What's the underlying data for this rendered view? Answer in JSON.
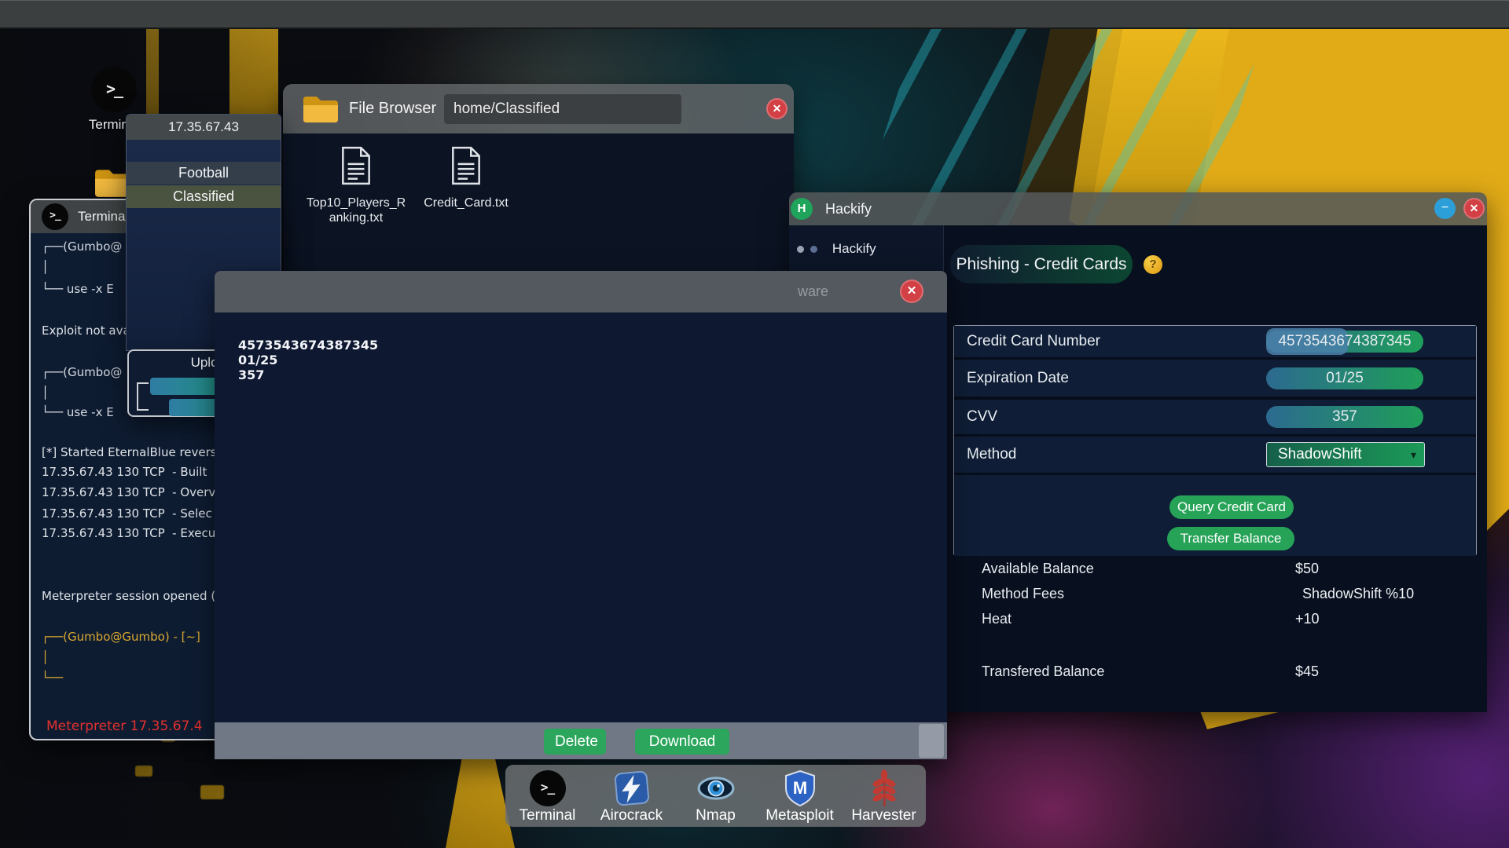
{
  "desktop": {
    "terminal_icon_label": "Terminal",
    "dock": [
      {
        "label": "Terminal"
      },
      {
        "label": "Airocrack"
      },
      {
        "label": "Nmap"
      },
      {
        "label": "Metasploit"
      },
      {
        "label": "Harvester"
      }
    ]
  },
  "server_panel": {
    "title": "17.35.67.43",
    "items": [
      {
        "label": "Football",
        "selected": false
      },
      {
        "label": "Classified",
        "selected": true
      }
    ]
  },
  "file_browser": {
    "title": "File Browser",
    "path": "home/Classified",
    "files": [
      {
        "name": "Top10_Players_Ranking.txt"
      },
      {
        "name": "Credit_Card.txt"
      }
    ]
  },
  "terminal_window": {
    "title": "Terminal",
    "lines": [
      {
        "text": "┌──(Gumbo@",
        "color": "#d5dae1"
      },
      {
        "text": "│",
        "color": "#d5dae1"
      },
      {
        "text": "└── use -x E",
        "color": "#d5dae1"
      },
      {
        "text": "Exploit not ava",
        "color": "#dfe3e8"
      },
      {
        "text": "┌──(Gumbo@",
        "color": "#d5dae1"
      },
      {
        "text": "│",
        "color": "#d5dae1"
      },
      {
        "text": "└── use -x E",
        "color": "#d5dae1"
      },
      {
        "text": "[*] Started EternalBlue revers",
        "color": "#dfe3e8"
      },
      {
        "text": "17.35.67.43 130 TCP  - Built",
        "color": "#dfe3e8"
      },
      {
        "text": "17.35.67.43 130 TCP  - Overv",
        "color": "#dfe3e8"
      },
      {
        "text": "17.35.67.43 130 TCP  - Selec",
        "color": "#dfe3e8"
      },
      {
        "text": "17.35.67.43 130 TCP  - Execu",
        "color": "#dfe3e8"
      },
      {
        "text": "Meterpreter session opened (",
        "color": "#dfe3e8"
      },
      {
        "text": "┌──(Gumbo@Gumbo) - [~]",
        "color": "#d9a92f"
      },
      {
        "text": "│",
        "color": "#d9a92f"
      },
      {
        "text": "└──",
        "color": "#d9a92f"
      },
      {
        "text": "Meterpreter 17.35.67.4",
        "color": "#e2312e"
      }
    ]
  },
  "upload_dialog": {
    "title": "Upload"
  },
  "text_viewer": {
    "title_fragment": "ware",
    "content_lines": [
      "4573543674387345",
      "01/25",
      "357"
    ],
    "delete_label": "Delete",
    "download_label": "Download"
  },
  "hackify": {
    "window_title": "Hackify",
    "sidebar_item": "Hackify",
    "module_title": "Phishing - Credit Cards",
    "help_glyph": "?",
    "fields": [
      {
        "label": "Credit Card Number",
        "value": "4573543674387345"
      },
      {
        "label": "Expiration Date",
        "value": "01/25"
      },
      {
        "label": "CVV",
        "value": "357"
      },
      {
        "label": "Method",
        "value": "ShadowShift"
      }
    ],
    "buttons": [
      {
        "label": "Query Credit Card"
      },
      {
        "label": "Transfer Balance"
      }
    ],
    "stats": [
      {
        "label": "Available Balance",
        "value": "$50"
      },
      {
        "label": "Method Fees",
        "value": "ShadowShift %10"
      },
      {
        "label": "Heat",
        "value": "+10"
      },
      {
        "label": "Transfered Balance",
        "value": "$45"
      }
    ]
  },
  "colors": {
    "accent_green": "#27a358",
    "prompt_yellow": "#d9a92f",
    "error_red": "#e2312e",
    "pill_left": "#2c6a90",
    "pill_right": "#1f9e59"
  }
}
